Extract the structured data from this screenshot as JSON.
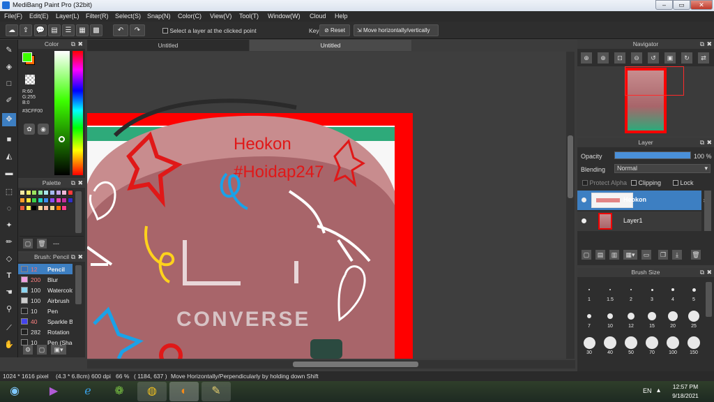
{
  "window": {
    "title": "MediBang Paint Pro (32bit)"
  },
  "menu": [
    "File(F)",
    "Edit(E)",
    "Layer(L)",
    "Filter(R)",
    "Select(S)",
    "Snap(N)",
    "Color(C)",
    "View(V)",
    "Tool(T)",
    "Window(W)",
    "Cloud",
    "Help"
  ],
  "toolbar": {
    "select_layer_label": "Select a layer at the clicked point",
    "key_label": "Key",
    "reset_label": "Reset",
    "move_label": "Move horizontally/vertically"
  },
  "tabs": [
    "Untitled",
    "Untitled"
  ],
  "color_panel": {
    "title": "Color",
    "r": "R:60",
    "g": "G:255",
    "b": "B:0",
    "hex": "#3CFF00",
    "primary": "#3cff00",
    "secondary": "#ff6a00"
  },
  "palette_panel": {
    "title": "Palette",
    "swatches": [
      "#f6e9a3",
      "#f1ee6b",
      "#9be35f",
      "#8ee5a4",
      "#a8e5ea",
      "#a5b9ee",
      "#c5a6ea",
      "#f0b7d8",
      "#ff3a3a",
      "#ff9c2b",
      "#ffe53a",
      "#3ad048",
      "#21cfc4",
      "#3c8af0",
      "#8d4cf0",
      "#ef46b8",
      "#c62e9e",
      "#2e2ec6",
      "#e85b3b",
      "#ffee55",
      "#000000",
      "#ffd89a",
      "#f4b5a0",
      "#efd18a",
      "#ff7a00",
      "#ff3c8e"
    ],
    "more": "---"
  },
  "brush_panel": {
    "title": "Brush: Pencil",
    "items": [
      {
        "size": "12",
        "name": "Pencil",
        "color": "#3a6fb6"
      },
      {
        "size": "200",
        "name": "Blur",
        "color": "#f0a0e0"
      },
      {
        "size": "100",
        "name": "Watercolor",
        "color": "#8ad4f0"
      },
      {
        "size": "100",
        "name": "Airbrush",
        "color": "#cccccc"
      },
      {
        "size": "10",
        "name": "Pen",
        "color": "#222222"
      },
      {
        "size": "40",
        "name": "Sparkle Brush",
        "color": "#4444ee"
      },
      {
        "size": "282",
        "name": "Rotation",
        "color": "#222222"
      },
      {
        "size": "10",
        "name": "Pen (Shading)",
        "color": "#222222"
      }
    ]
  },
  "navigator": {
    "title": "Navigator"
  },
  "layer_panel": {
    "title": "Layer",
    "opacity_label": "Opacity",
    "opacity_value": "100 %",
    "opacity_fraction": 1.0,
    "blending_label": "Blending",
    "blending_value": "Normal",
    "protect_alpha": "Protect Alpha",
    "clipping": "Clipping",
    "lock": "Lock",
    "layers": [
      {
        "name": "Heokon"
      },
      {
        "name": "Layer1"
      }
    ]
  },
  "brush_size_panel": {
    "title": "Brush Size",
    "sizes": [
      "1",
      "1.5",
      "2",
      "3",
      "4",
      "5",
      "7",
      "10",
      "12",
      "15",
      "20",
      "25",
      "30",
      "40",
      "50",
      "70",
      "100",
      "150"
    ]
  },
  "artwork": {
    "line1": "Heokon",
    "line2": "#Hoidap247",
    "brand": "CONVERSE"
  },
  "status": {
    "dimensions": "1024 * 1616 pixel",
    "size_cm": "(4.3 * 6.8cm)",
    "dpi": "600 dpi",
    "zoom": "66 %",
    "coords": "( 1184, 637 )",
    "hint": "Move Horizontally/Perpendicularly by holding down Shift"
  },
  "taskbar": {
    "lang": "EN",
    "time": "12:57 PM",
    "date": "9/18/2021"
  }
}
